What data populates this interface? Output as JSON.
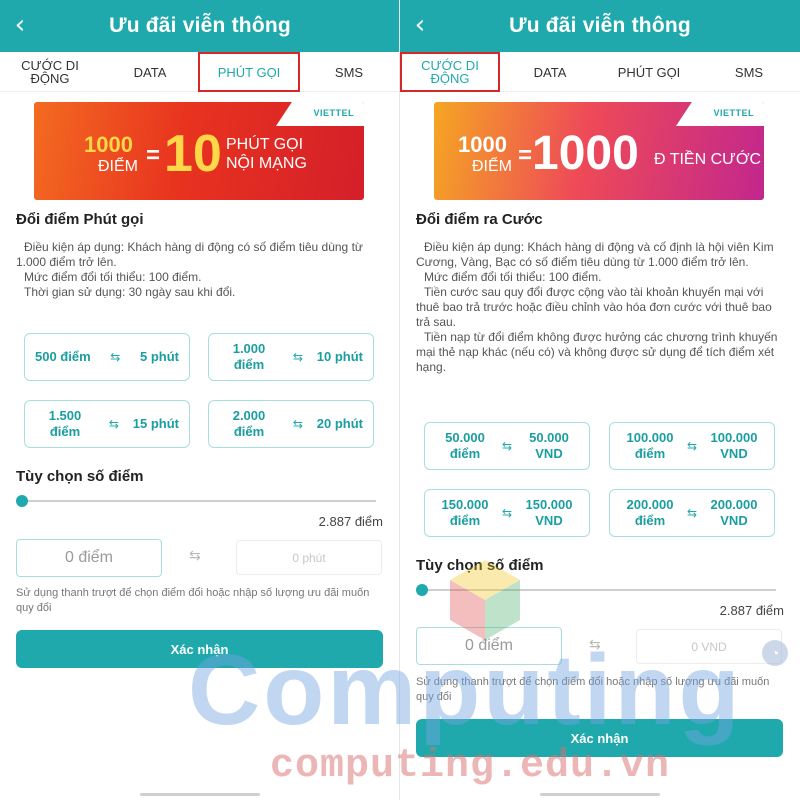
{
  "left": {
    "header": {
      "title": "Ưu đãi viễn thông",
      "back_icon": "‹"
    },
    "tabs": [
      {
        "label": "CƯỚC DI\nĐỘNG"
      },
      {
        "label": "DATA"
      },
      {
        "label": "PHÚT GỌI"
      },
      {
        "label": "SMS"
      }
    ],
    "active_tab": "PHÚT GỌI",
    "banner": {
      "logo": "VIETTEL",
      "points_number": "1000",
      "points_word": "ĐIỂM",
      "equals": "=",
      "big_value": "10",
      "description": "PHÚT GỌI\nNỘI MẠNG"
    },
    "section_title": "Đổi điểm Phút gọi",
    "conditions": [
      "Điều kiện áp dụng: Khách hàng di động có số điểm tiêu dùng từ 1.000 điểm trở lên.",
      "Mức điểm đổi tối thiểu: 100 điểm.",
      "Thời gian sử dụng: 30 ngày sau khi đổi."
    ],
    "options": [
      {
        "points": "500 điểm",
        "value": "5 phút"
      },
      {
        "points": "1.000\nđiểm",
        "value": "10 phút"
      },
      {
        "points": "1.500\nđiểm",
        "value": "15 phút"
      },
      {
        "points": "2.000\nđiểm",
        "value": "20 phút"
      }
    ],
    "custom_title": "Tùy chọn số điểm",
    "slider_value_fraction": 0,
    "max_points": "2.887 điểm",
    "input_value": "0 điểm",
    "output_value": "0 phút",
    "hint": "Sử dụng thanh trượt để chọn điểm đổi hoặc nhập số lượng ưu đãi muốn quy đổi",
    "confirm_label": "Xác nhận"
  },
  "right": {
    "header": {
      "title": "Ưu đãi viễn thông",
      "back_icon": "‹"
    },
    "tabs": [
      {
        "label": "CƯỚC DI\nĐỘNG"
      },
      {
        "label": "DATA"
      },
      {
        "label": "PHÚT GỌI"
      },
      {
        "label": "SMS"
      }
    ],
    "active_tab": "CƯỚC DI ĐỘNG",
    "banner": {
      "logo": "VIETTEL",
      "points_number": "1000",
      "points_word": "ĐIỂM",
      "equals": "=",
      "big_value": "1000",
      "description": "Đ TIỀN CƯỚC"
    },
    "section_title": "Đổi điểm ra Cước",
    "conditions": [
      "Điều kiện áp dụng: Khách hàng di động và cố định là hội viên Kim Cương, Vàng, Bạc có số điểm tiêu dùng từ 1.000 điểm trở lên.",
      "Mức điểm đổi tối thiểu: 100 điểm.",
      "Tiền cước sau quy đổi được cộng vào tài khoản khuyến mại với thuê bao trả trước hoặc điều chỉnh vào hóa đơn cước với thuê bao trả sau.",
      "Tiền nạp từ đổi điểm không được hưởng các chương trình khuyến mại thẻ nạp khác (nếu có) và không được sử dụng để tích điểm xét hạng."
    ],
    "options": [
      {
        "points": "50.000\nđiểm",
        "value": "50.000\nVND"
      },
      {
        "points": "100.000\nđiểm",
        "value": "100.000\nVND"
      },
      {
        "points": "150.000\nđiểm",
        "value": "150.000\nVND"
      },
      {
        "points": "200.000\nđiểm",
        "value": "200.000\nVND"
      }
    ],
    "custom_title": "Tùy chọn số điểm",
    "slider_value_fraction": 0,
    "max_points": "2.887 điểm",
    "input_value": "0 điểm",
    "output_value": "0 VND",
    "hint": "Sử dụng thanh trượt để chọn điểm đổi hoặc nhập số lượng ưu đãi muốn quy đổi",
    "confirm_label": "Xác nhận"
  },
  "watermark": {
    "word": "Computing",
    "url": "computing.edu.vn"
  },
  "swap_icon": "⇆",
  "colors": {
    "primary": "#1fa9ac",
    "highlight_border": "#d62828",
    "option_border": "#a9dedf"
  }
}
